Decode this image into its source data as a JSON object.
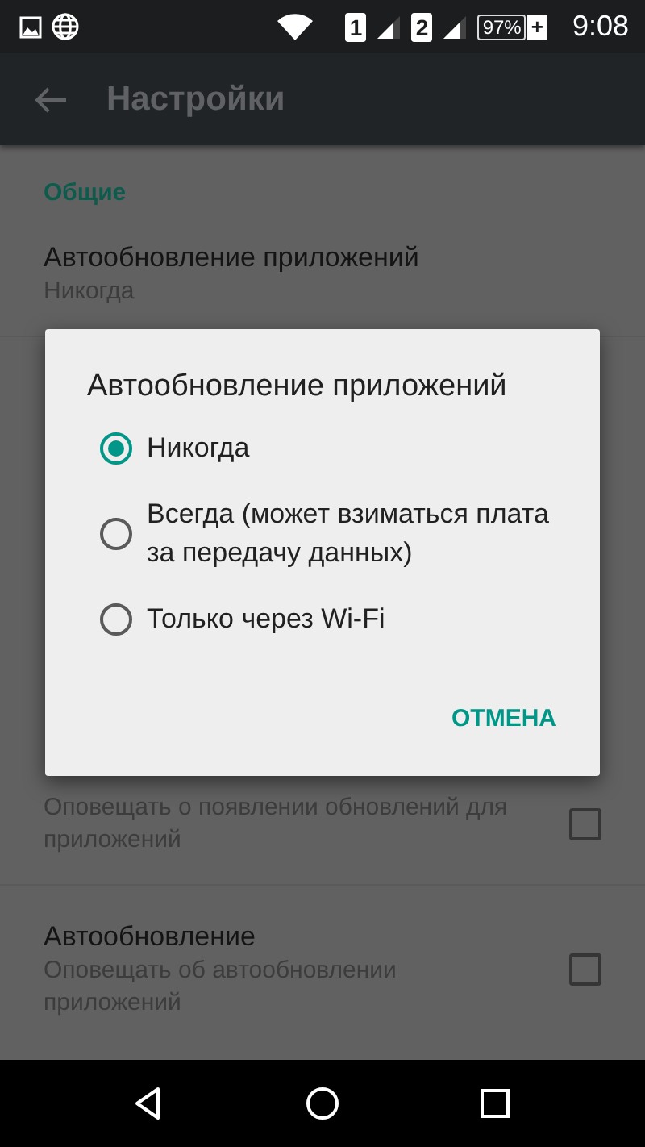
{
  "status_bar": {
    "sim_1": "1",
    "sim_2": "2",
    "battery": "97%",
    "charging": "+",
    "time": "9:08"
  },
  "app_bar": {
    "title": "Настройки"
  },
  "settings": {
    "section": "Общие",
    "items": [
      {
        "kind": "list",
        "title": "Автообновление приложений",
        "summary": "Никогда"
      },
      {
        "kind": "checkbox",
        "summary": "Оповещать о появлении обновлений для приложений",
        "checked": false
      },
      {
        "kind": "checkbox",
        "title": "Автообновление",
        "summary": "Оповещать об автообновлении приложений",
        "checked": false
      }
    ]
  },
  "dialog": {
    "title": "Автообновление приложений",
    "options": [
      {
        "label": "Никогда",
        "selected": true
      },
      {
        "label": "Всегда (может взиматься плата за передачу данных)",
        "selected": false
      },
      {
        "label": "Только через Wi-Fi",
        "selected": false
      }
    ],
    "button": "ОТМЕНА"
  }
}
